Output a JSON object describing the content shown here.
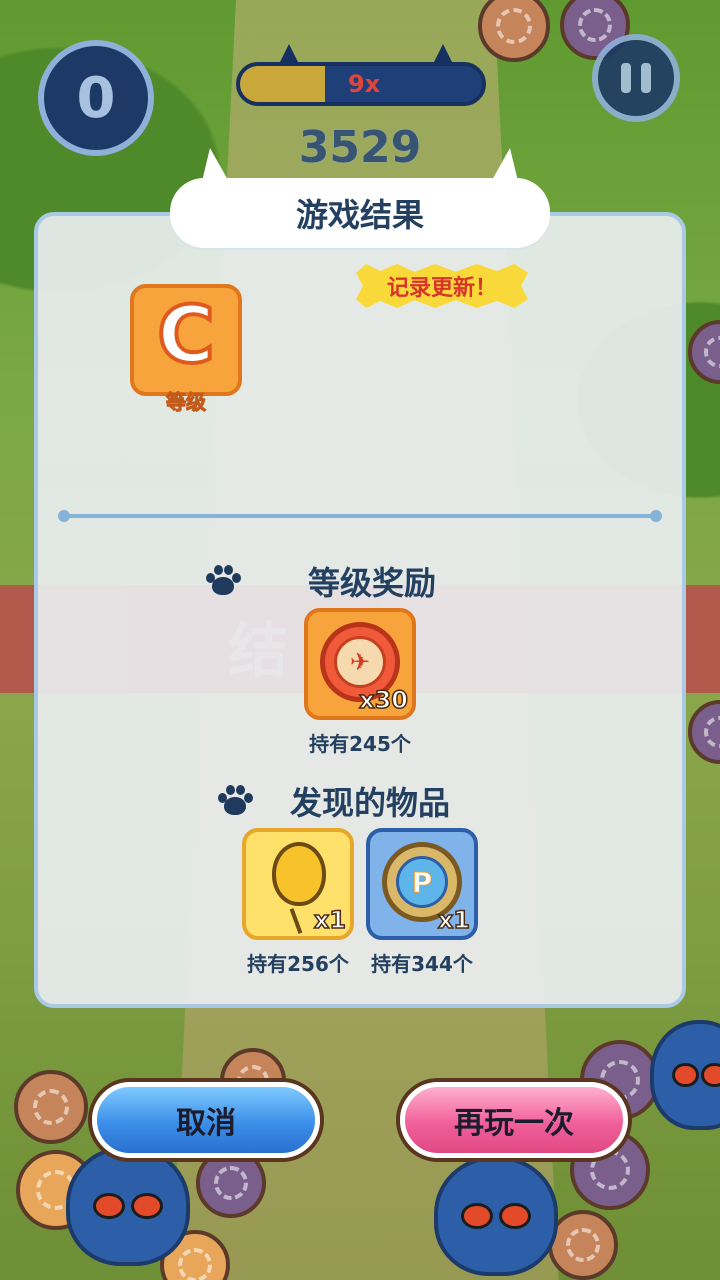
{
  "hud": {
    "left_counter": "0",
    "multiplier_text": "9x",
    "score": "3529",
    "multiplier_progress_percent": 35
  },
  "background": {
    "band_text": "结"
  },
  "dialog": {
    "title": "游戏结果",
    "record_tag": "记录更新！",
    "rank": {
      "letter": "C",
      "label": "等级"
    },
    "rank_reward": {
      "heading": "等级奖励",
      "item": {
        "icon": "red-coin-icon",
        "count": "x30",
        "held": "持有245个"
      }
    },
    "found_items": {
      "heading": "发现的物品",
      "items": [
        {
          "icon": "yellow-balloon-icon",
          "count": "x1",
          "held": "持有256个"
        },
        {
          "icon": "p-ticket-icon",
          "count": "x1",
          "held": "持有344个"
        }
      ]
    }
  },
  "buttons": {
    "cancel": "取消",
    "play_again": "再玩一次"
  },
  "colors": {
    "panel_border": "#a9c9e4",
    "rank_orange": "#f7a43c",
    "record_yellow": "#f9d93a",
    "cancel_blue": "#3b8fe8",
    "again_pink": "#f0609a",
    "navy_text": "#234060"
  }
}
